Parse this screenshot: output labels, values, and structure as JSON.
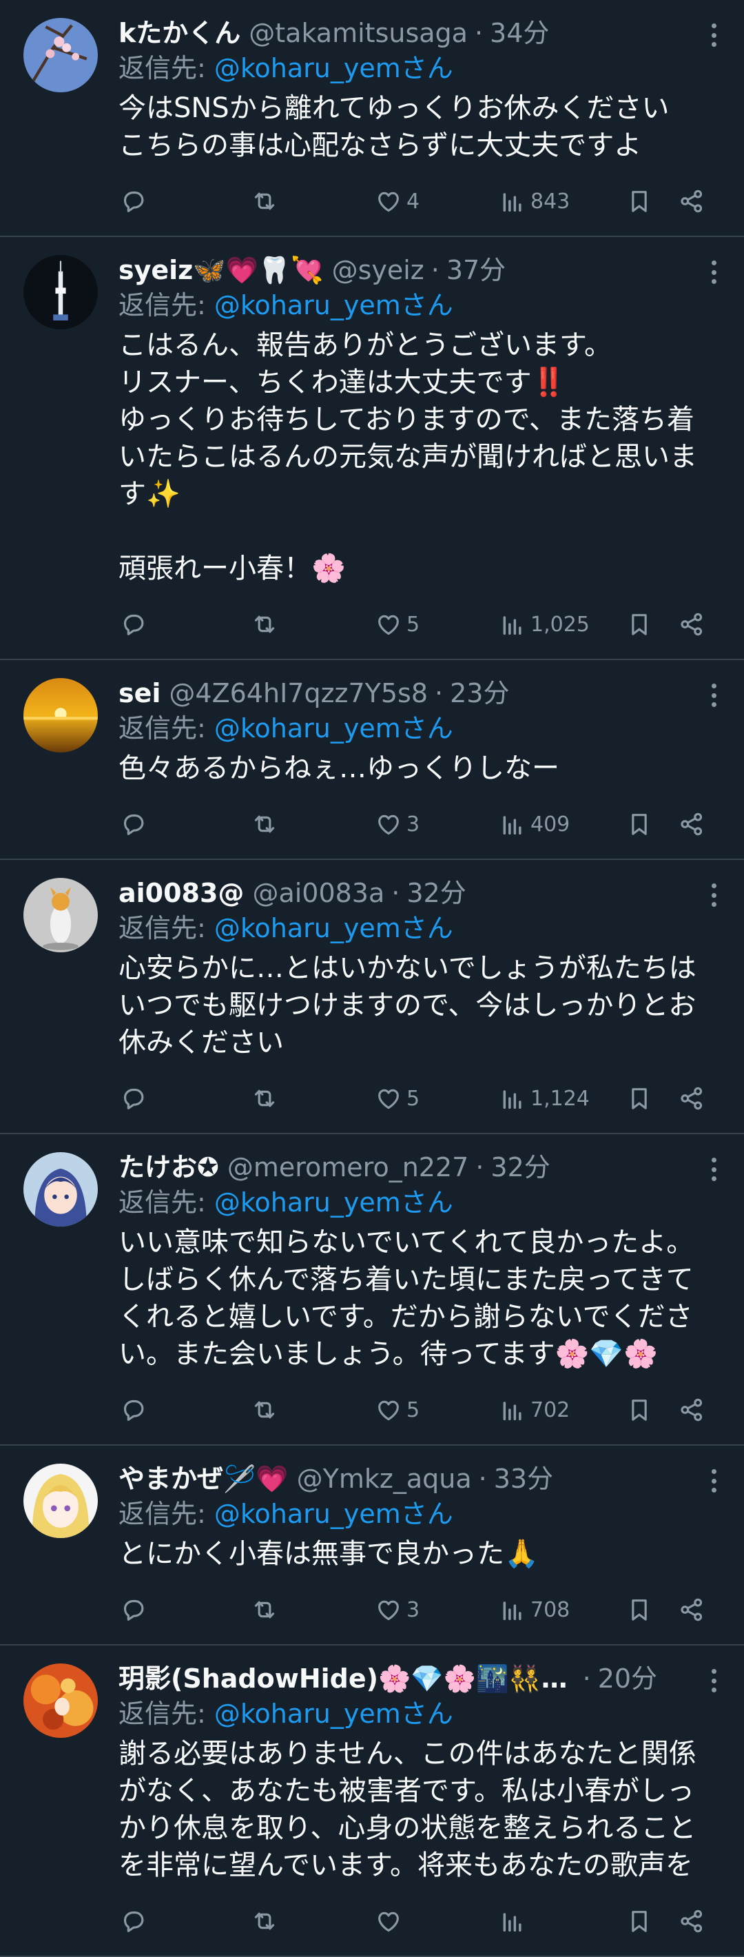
{
  "tweets": [
    {
      "name": "kたかくん",
      "handle": "@takamitsusaga",
      "separator": "·",
      "time": "34分",
      "reply_prefix": "返信先: ",
      "reply_mention": "@koharu_yemさん",
      "text": "今はSNSから離れてゆっくりお休みください\nこちらの事は心配なさらずに大丈夫ですよ",
      "replies": "",
      "retweets": "",
      "likes": "4",
      "views": "843"
    },
    {
      "name": "syeiz🦋💗🦷💘",
      "handle": "@syeiz",
      "separator": "·",
      "time": "37分",
      "reply_prefix": "返信先: ",
      "reply_mention": "@koharu_yemさん",
      "text": "こはるん、報告ありがとうございます。\nリスナー、ちくわ達は大丈夫です‼️\nゆっくりお待ちしておりますので、また落ち着いたらこはるんの元気な声が聞ければと思います✨\n\n頑張れー小春！🌸",
      "replies": "",
      "retweets": "",
      "likes": "5",
      "views": "1,025"
    },
    {
      "name": "sei",
      "handle": "@4Z64hI7qzz7Y5s8",
      "separator": "·",
      "time": "23分",
      "reply_prefix": "返信先: ",
      "reply_mention": "@koharu_yemさん",
      "text": "色々あるからねぇ…ゆっくりしなー",
      "replies": "",
      "retweets": "",
      "likes": "3",
      "views": "409"
    },
    {
      "name": "ai0083@",
      "handle": "@ai0083a",
      "separator": "·",
      "time": "32分",
      "reply_prefix": "返信先: ",
      "reply_mention": "@koharu_yemさん",
      "text": "心安らかに…とはいかないでしょうが私たちはいつでも駆けつけますので、今はしっかりとお休みください",
      "replies": "",
      "retweets": "",
      "likes": "5",
      "views": "1,124"
    },
    {
      "name": "たけお✪",
      "handle": "@meromero_n227",
      "separator": "·",
      "time": "32分",
      "reply_prefix": "返信先: ",
      "reply_mention": "@koharu_yemさん",
      "text": "いい意味で知らないでいてくれて良かったよ。しばらく休んで落ち着いた頃にまた戻ってきてくれると嬉しいです。だから謝らないでください。また会いましょう。待ってます🌸💎🌸",
      "replies": "",
      "retweets": "",
      "likes": "5",
      "views": "702"
    },
    {
      "name": "やまかぜ🪡💗",
      "handle": "@Ymkz_aqua",
      "separator": "·",
      "time": "33分",
      "reply_prefix": "返信先: ",
      "reply_mention": "@koharu_yemさん",
      "text": "とにかく小春は無事で良かった🙏",
      "replies": "",
      "retweets": "",
      "likes": "3",
      "views": "708"
    },
    {
      "name": "玥影(ShadowHide)🌸💎🌸🌃👯…",
      "handle": "",
      "separator": "·",
      "time": "20分",
      "reply_prefix": "返信先: ",
      "reply_mention": "@koharu_yemさん",
      "text": "謝る必要はありません、この件はあなたと関係がなく、あなたも被害者です。私は小春がしっかり休息を取り、心身の状態を整えられることを非常に望んでいます。将来もあなたの歌声を",
      "replies": "",
      "retweets": "",
      "likes": "",
      "views": ""
    }
  ],
  "colors": {
    "background": "#15202b",
    "divider": "#38444d",
    "text_primary": "#f7f9f9",
    "text_secondary": "#8b98a5",
    "mention": "#1d9bf0"
  },
  "icons": [
    "reply-icon",
    "retweet-icon",
    "like-icon",
    "views-icon",
    "bookmark-icon",
    "share-icon",
    "more-icon"
  ]
}
